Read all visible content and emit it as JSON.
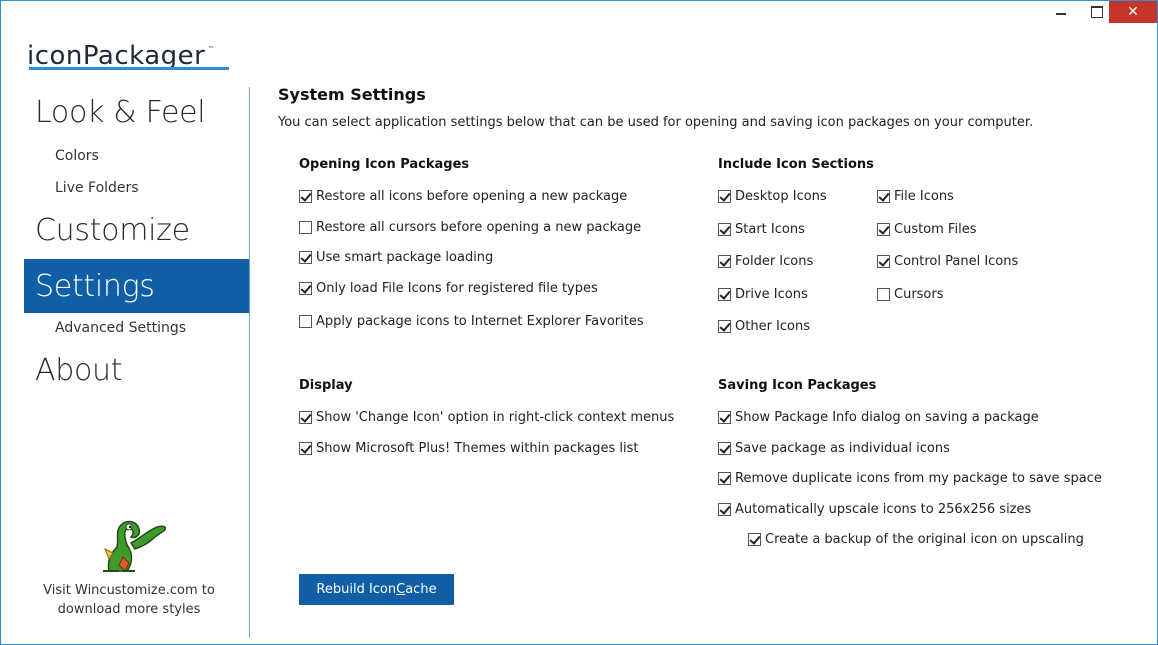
{
  "app": {
    "logo_text": "iconPackager",
    "logo_tm": "™",
    "close_glyph": "✕"
  },
  "sidebar": {
    "major": [
      {
        "label": "Look & Feel"
      },
      {
        "label": "Customize"
      },
      {
        "label": "Settings"
      },
      {
        "label": "About"
      }
    ],
    "minor": [
      {
        "label": "Colors"
      },
      {
        "label": "Live Folders"
      },
      {
        "label": "Advanced Settings"
      }
    ],
    "promo_line1": "Visit Wincustomize.com to",
    "promo_line2": "download more styles"
  },
  "main": {
    "title": "System Settings",
    "subtitle": "You can select application settings below that can be used for opening and saving icon packages on your computer.",
    "opening": {
      "heading": "Opening Icon Packages",
      "items": [
        {
          "label": "Restore all icons before opening a new package",
          "checked": true
        },
        {
          "label": "Restore all cursors before opening a new package",
          "checked": false
        },
        {
          "label": "Use smart package loading",
          "checked": true
        },
        {
          "label": "Only load File Icons for registered file types",
          "checked": true
        },
        {
          "label": "Apply package icons to Internet Explorer Favorites",
          "checked": false
        }
      ]
    },
    "sections": {
      "heading": "Include Icon Sections",
      "items": [
        {
          "label": "Desktop Icons",
          "checked": true
        },
        {
          "label": "Start Icons",
          "checked": true
        },
        {
          "label": "Folder Icons",
          "checked": true
        },
        {
          "label": "Drive Icons",
          "checked": true
        },
        {
          "label": "Other Icons",
          "checked": true
        },
        {
          "label": "File Icons",
          "checked": true
        },
        {
          "label": "Custom Files",
          "checked": true
        },
        {
          "label": "Control Panel Icons",
          "checked": true
        },
        {
          "label": "Cursors",
          "checked": false
        }
      ]
    },
    "display": {
      "heading": "Display",
      "items": [
        {
          "label": "Show 'Change Icon' option in right-click context menus",
          "checked": true
        },
        {
          "label": "Show Microsoft Plus! Themes within packages list",
          "checked": true
        }
      ]
    },
    "saving": {
      "heading": "Saving Icon Packages",
      "items": [
        {
          "label": "Show Package Info dialog on saving a package",
          "checked": true
        },
        {
          "label": "Save package as individual icons",
          "checked": true
        },
        {
          "label": "Remove duplicate icons from my package to save space",
          "checked": true
        },
        {
          "label": "Automatically upscale icons to 256x256 sizes",
          "checked": true
        },
        {
          "label": "Create a backup of the original icon on upscaling",
          "checked": true
        }
      ]
    },
    "rebuild_button": {
      "label_before": "Rebuild Icon ",
      "label_accel": "C",
      "label_after": "ache"
    }
  }
}
